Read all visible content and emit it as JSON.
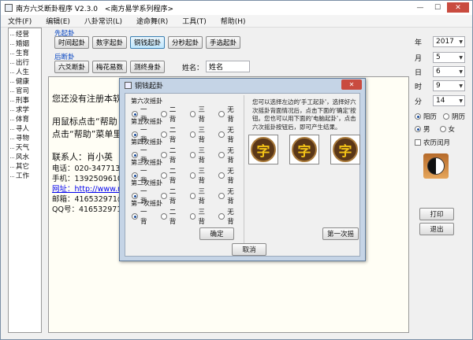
{
  "window": {
    "title": "南方六爻断卦程序 V2.3.0　<南方易学系列程序>",
    "min": "—",
    "max": "☐",
    "close": "✕"
  },
  "menu": [
    "文件(F)",
    "编辑(E)",
    "八卦常识(L)",
    "途命舞(R)",
    "工具(T)",
    "帮助(H)"
  ],
  "sidebar": [
    "经营",
    "婚姻",
    "生育",
    "出行",
    "人生",
    "健康",
    "官司",
    "刑事",
    "求学",
    "体育",
    "寻人",
    "寻物",
    "天气",
    "风水",
    "其它",
    "工作"
  ],
  "qigua": {
    "title": "先起卦",
    "buttons": [
      "时间起卦",
      "数字起卦",
      "铜钱起卦",
      "分秒起卦",
      "手选起卦"
    ],
    "selected": "铜钱起卦"
  },
  "duangua": {
    "title": "后断卦",
    "buttons": [
      "六爻断卦",
      "梅花易数",
      "测终身卦"
    ]
  },
  "name": {
    "label": "姓名：",
    "value": "姓名"
  },
  "text": {
    "lines": [
      "您还没有注册本软件",
      "",
      "用鼠标点击“帮助",
      "点击“帮助”菜单里",
      "",
      "联系人：肖小英",
      "电话：020-34771385",
      "手机：13925096102",
      "网址：http://www.n",
      "邮箱：416532971@qq",
      "QQ号：416532971"
    ]
  },
  "right": {
    "year": {
      "label": "年",
      "value": "2017"
    },
    "month": {
      "label": "月",
      "value": "5"
    },
    "day": {
      "label": "日",
      "value": "6"
    },
    "hour": {
      "label": "时",
      "value": "9"
    },
    "minute": {
      "label": "分",
      "value": "14"
    },
    "calendar": [
      "阳历",
      "阴历"
    ],
    "calendar_selected": "阳历",
    "gender": [
      "男",
      "女"
    ],
    "gender_selected": "男",
    "leap": "农历闰月",
    "print": "打印",
    "exit": "退出"
  },
  "dialog": {
    "title": "铜钱起卦",
    "yao": [
      {
        "title": "第六次摇卦",
        "selected": "一背"
      },
      {
        "title": "第五次摇卦",
        "selected": "一背"
      },
      {
        "title": "第四次摇卦",
        "selected": "一背"
      },
      {
        "title": "第三次摇卦",
        "selected": "一背"
      },
      {
        "title": "第二次摇卦",
        "selected": "一背"
      },
      {
        "title": "第一次摇卦",
        "selected": "一背"
      }
    ],
    "options": [
      "一背",
      "二背",
      "三背",
      "无背"
    ],
    "info": "您可以选择左边的'手工起卦'，选择好六次摇卦背面情况后，点击下面的'确定'按钮。您也可以用下面的'电脑起卦'，点击六次摇卦按钮后，即可产生结果。",
    "coin_char": "字",
    "ok": "确定",
    "first_shake": "第一次摇",
    "cancel": "取消"
  }
}
